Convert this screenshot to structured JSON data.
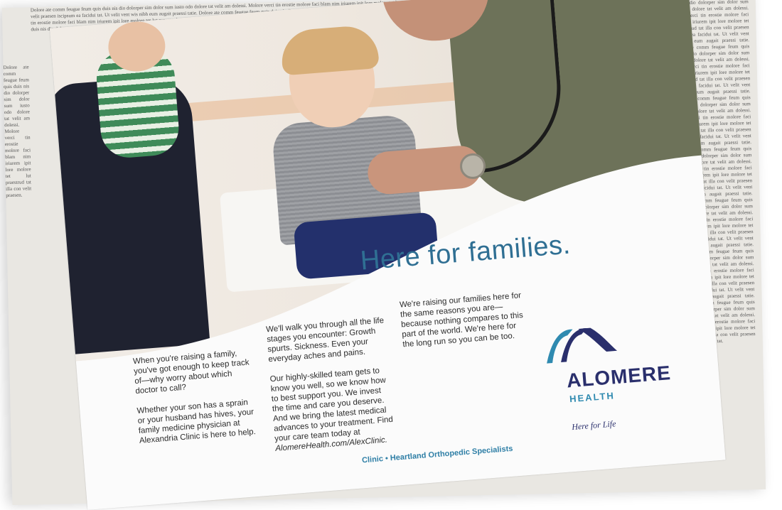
{
  "ad": {
    "headline": "Here for families.",
    "column1": {
      "para1": "When you're raising a family, you've got enough to keep track of—why worry about which doctor to call?",
      "para2": "Whether your son has a sprain or your husband has hives, your family medicine physician at Alexandria Clinic is here to help."
    },
    "column2": {
      "para1": "We'll walk you through all the life stages you encounter: Growth spurts. Sickness. Even your everyday aches and pains.",
      "para2": "Our highly-skilled team gets to know you well, so we know how to best support you. We invest the time and care you deserve. And we bring the latest medical advances to your treatment. Find your care team today at",
      "url": "AlomereHealth.com/AlexClinic."
    },
    "column3": {
      "para1": "We're raising our families here for the same reasons you are—because nothing compares to this part of the world. We're here for the long run so you can be too."
    },
    "logo": {
      "name": "ALOMERE",
      "sub": "HEALTH",
      "tagline": "Here for Life"
    },
    "footer": "Clinic • Heartland Orthopedic Specialists"
  },
  "colors": {
    "headline": "#2f6f93",
    "brand_navy": "#2a2f6c",
    "brand_teal": "#2f8ab0"
  }
}
